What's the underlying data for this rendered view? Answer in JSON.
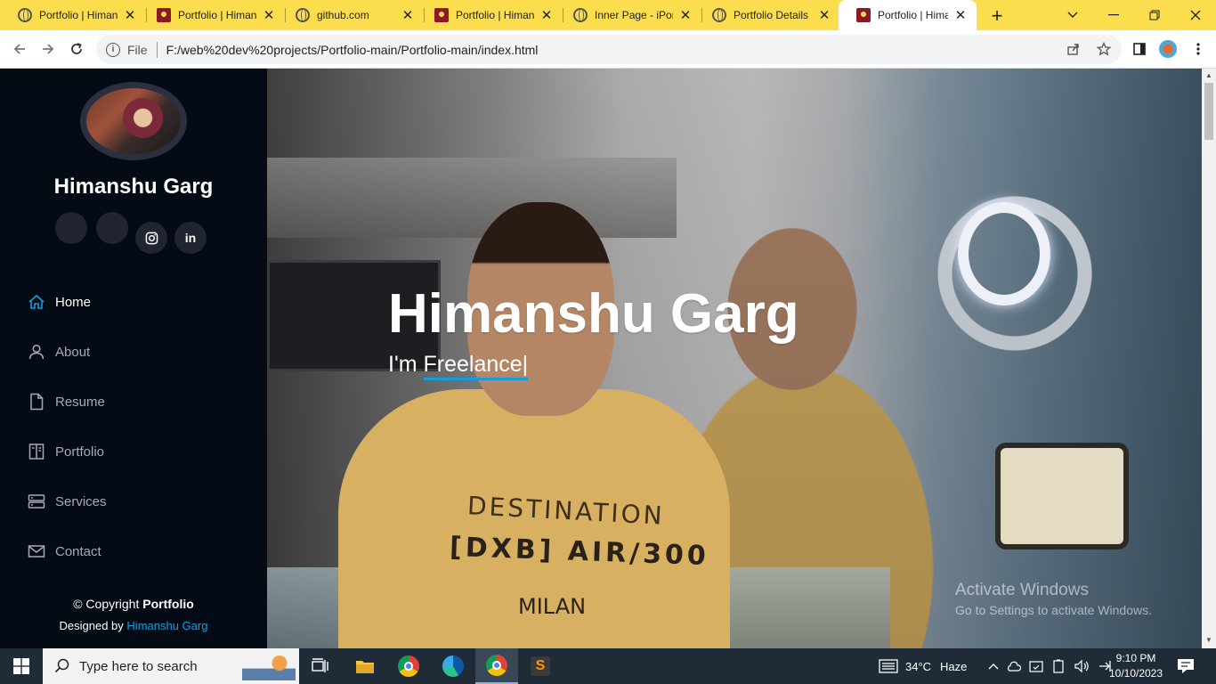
{
  "browser": {
    "tabs": [
      {
        "title": "Portfolio | Himanshu",
        "favicon": "globe-icon"
      },
      {
        "title": "Portfolio | Himanshu",
        "favicon": "portfolio-icon"
      },
      {
        "title": "github.com",
        "favicon": "globe-icon"
      },
      {
        "title": "Portfolio | Himanshu",
        "favicon": "portfolio-icon"
      },
      {
        "title": "Inner Page - iPortfolio",
        "favicon": "globe-icon"
      },
      {
        "title": "Portfolio Details",
        "favicon": "globe-icon"
      },
      {
        "title": "Portfolio | Himanshu",
        "favicon": "portfolio-icon",
        "active": true
      }
    ],
    "file_label": "File",
    "url": "F:/web%20dev%20projects/Portfolio-main/Portfolio-main/index.html",
    "tabstrip_color": "#fbdd4d"
  },
  "sidebar": {
    "name": "Himanshu Garg",
    "social": [
      "twitter-icon",
      "facebook-icon",
      "instagram-icon",
      "linkedin-icon"
    ],
    "linkedin_label": "in",
    "nav": [
      {
        "label": "Home",
        "icon": "home-icon",
        "active": true
      },
      {
        "label": "About",
        "icon": "person-icon"
      },
      {
        "label": "Resume",
        "icon": "file-icon"
      },
      {
        "label": "Portfolio",
        "icon": "book-icon"
      },
      {
        "label": "Services",
        "icon": "server-icon"
      },
      {
        "label": "Contact",
        "icon": "envelope-icon"
      }
    ],
    "copyright_prefix": "© Copyright",
    "copyright_brand": "Portfolio",
    "designed_prefix": "Designed by",
    "designed_link": "Himanshu Garg",
    "bg_color": "#040b14",
    "accent_color": "#149ddd"
  },
  "hero": {
    "title": "Himanshu Garg",
    "subtitle_prefix": "I'm",
    "subtitle_typed": "Freelance",
    "cursor": "|",
    "shirt_text_1": "DESTINATION",
    "shirt_text_2": "[DXB] AIR/300",
    "shirt_text_3": "MILAN"
  },
  "watermark": {
    "line1": "Activate Windows",
    "line2": "Go to Settings to activate Windows."
  },
  "taskbar": {
    "search_placeholder": "Type here to search",
    "weather_temp": "34°C",
    "weather_label": "Haze",
    "time": "9:10 PM",
    "date": "10/10/2023",
    "apps": [
      "task-view-icon",
      "file-explorer-icon",
      "chrome-icon",
      "edge-icon",
      "chrome-profile-icon",
      "sublime-text-icon"
    ]
  }
}
